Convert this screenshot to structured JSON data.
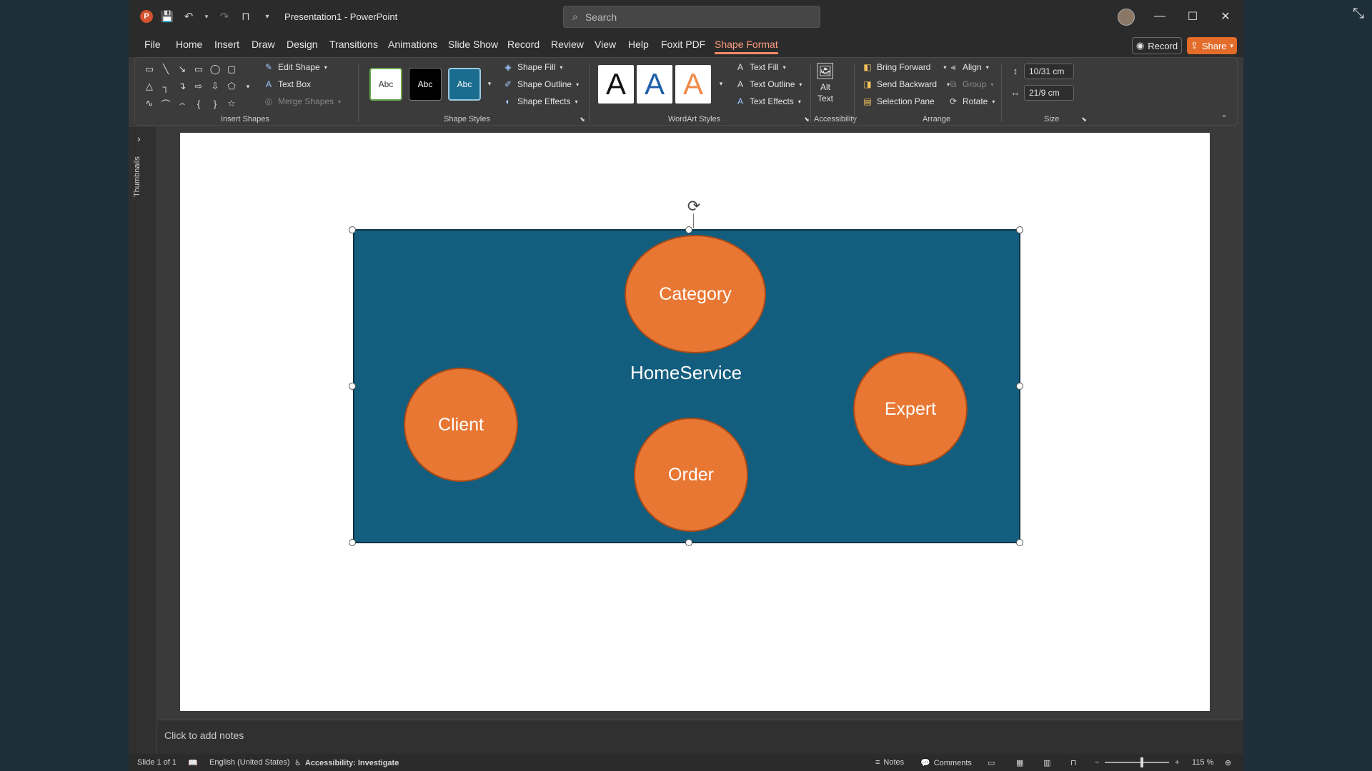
{
  "window": {
    "doc_title": "Presentation1  -  PowerPoint",
    "search_placeholder": "Search"
  },
  "menu": {
    "tabs": [
      "File",
      "Home",
      "Insert",
      "Draw",
      "Design",
      "Transitions",
      "Animations",
      "Slide Show",
      "Record",
      "Review",
      "View",
      "Help",
      "Foxit PDF",
      "Shape Format"
    ],
    "active_tab": "Shape Format",
    "record_label": "Record",
    "share_label": "Share"
  },
  "ribbon": {
    "insert_shapes": {
      "label": "Insert Shapes",
      "edit_shape": "Edit Shape",
      "text_box": "Text Box",
      "merge_shapes": "Merge Shapes"
    },
    "shape_styles": {
      "label": "Shape Styles",
      "swatch_text": "Abc",
      "shape_fill": "Shape Fill",
      "shape_outline": "Shape Outline",
      "shape_effects": "Shape Effects"
    },
    "wordart": {
      "label": "WordArt Styles",
      "letter": "A",
      "text_fill": "Text Fill",
      "text_outline": "Text Outline",
      "text_effects": "Text Effects"
    },
    "accessibility": {
      "label": "Accessibility",
      "alt_text_line1": "Alt",
      "alt_text_line2": "Text"
    },
    "arrange": {
      "label": "Arrange",
      "bring_forward": "Bring Forward",
      "send_backward": "Send Backward",
      "selection_pane": "Selection Pane",
      "align": "Align",
      "group": "Group",
      "rotate": "Rotate"
    },
    "size": {
      "label": "Size",
      "height": "10/31 cm",
      "width": "21/9 cm"
    }
  },
  "sidebar": {
    "thumbnails_label": "Thumbnails"
  },
  "slide": {
    "center_text": "HomeService",
    "circles": {
      "category": "Category",
      "client": "Client",
      "order": "Order",
      "expert": "Expert"
    },
    "colors": {
      "background": "#135e7e",
      "circle": "#e87733"
    }
  },
  "notes": {
    "placeholder": "Click to add notes"
  },
  "status": {
    "slide_info": "Slide 1 of 1",
    "language": "English (United States)",
    "accessibility": "Accessibility: Investigate",
    "notes": "Notes",
    "comments": "Comments",
    "zoom": "115 %"
  }
}
